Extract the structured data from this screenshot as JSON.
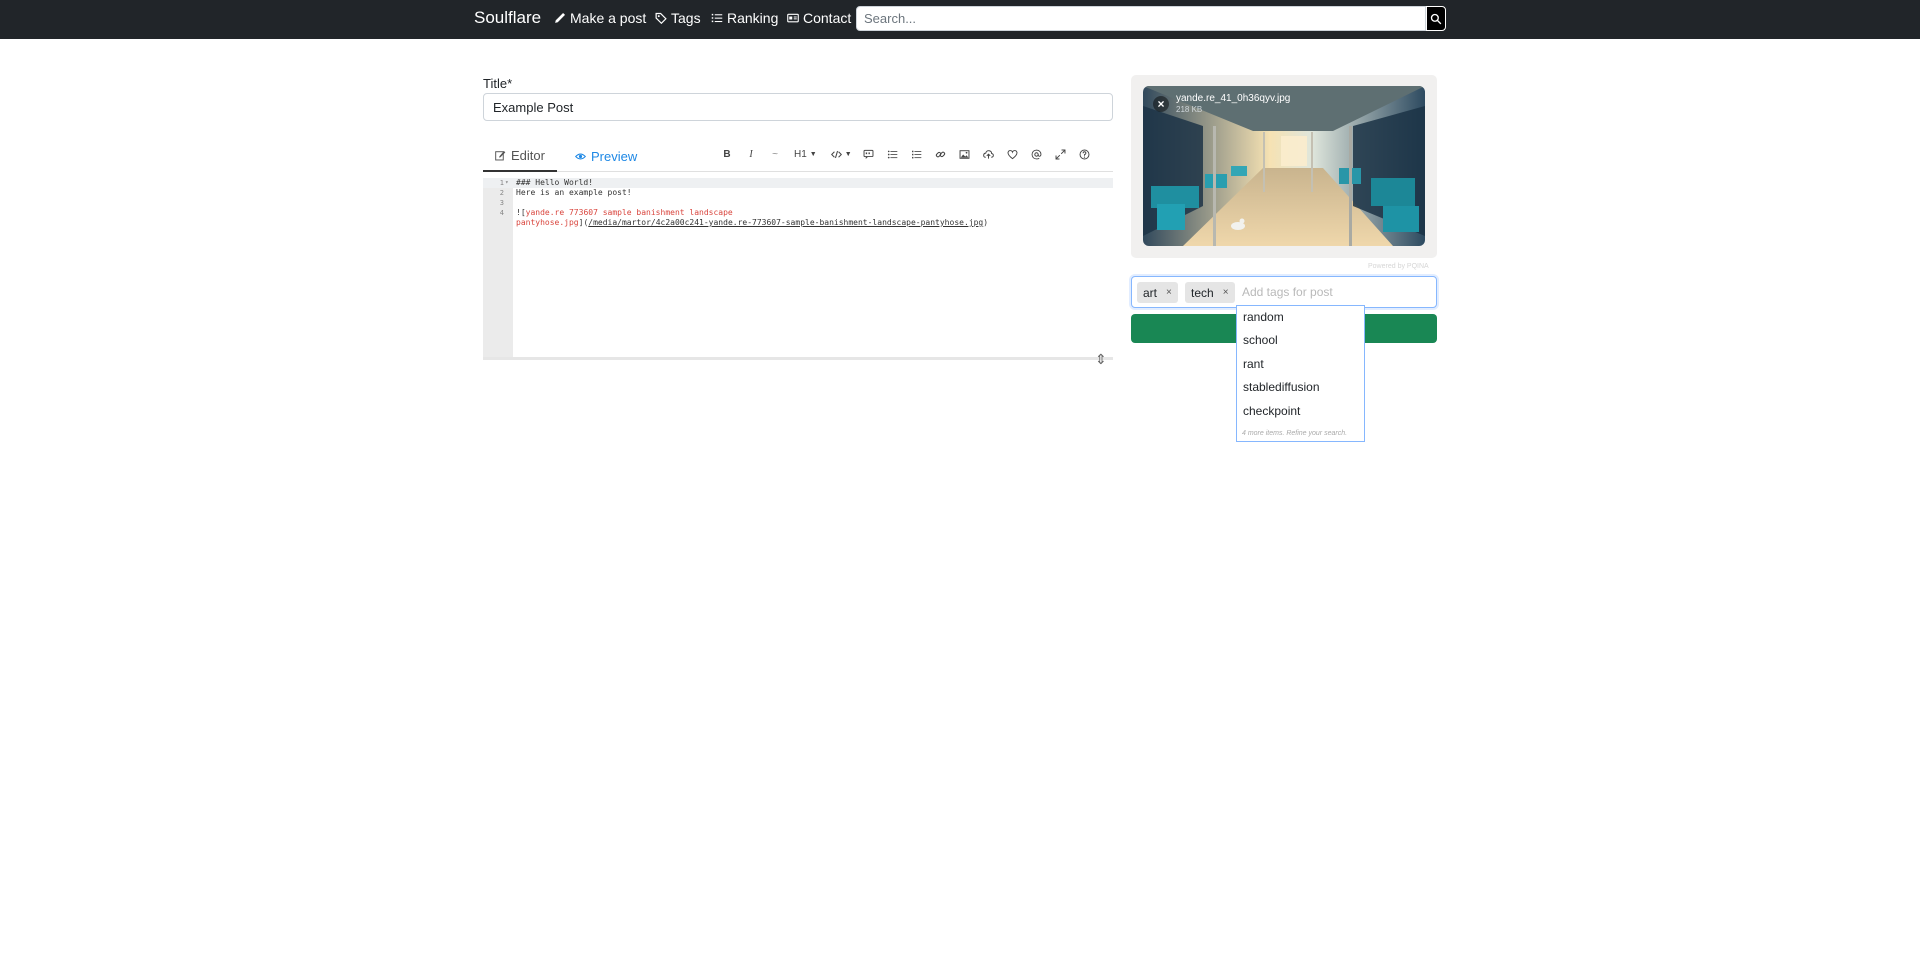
{
  "navbar": {
    "brand": "Soulflare",
    "items": [
      {
        "label": "Make a post",
        "icon": "pencil-icon"
      },
      {
        "label": "Tags",
        "icon": "tag-icon"
      },
      {
        "label": "Ranking",
        "icon": "list-icon"
      },
      {
        "label": "Contact",
        "icon": "contact-card-icon"
      }
    ],
    "search_placeholder": "Search...",
    "search_icon": "search-icon"
  },
  "form": {
    "title_label": "Title*",
    "title_value": "Example Post"
  },
  "editor": {
    "tabs": [
      {
        "label": "Editor",
        "icon": "edit-icon",
        "active": true
      },
      {
        "label": "Preview",
        "icon": "eye-icon",
        "active": false
      }
    ],
    "toolbar": {
      "bold": "B",
      "italic": "I",
      "strikethrough": "~",
      "heading": "H1",
      "code_icon": "code-icon",
      "tools": [
        "quote-icon",
        "bullet-list-icon",
        "numbered-list-icon",
        "link-icon",
        "image-icon",
        "upload-icon",
        "heart-icon",
        "mention-icon",
        "fullscreen-icon",
        "help-icon"
      ]
    },
    "lines": [
      {
        "num": "1",
        "text": "### Hello World!"
      },
      {
        "num": "2",
        "text": "Here is an example post!"
      },
      {
        "num": "3",
        "text": ""
      },
      {
        "num": "4",
        "prefix": "![",
        "alt": "yande.re 773607 sample banishment landscape",
        "alt_cont": "pantyhose.jpg",
        "mid": "](",
        "url": "/media/martor/4c2a00c241-yande.re-773607-sample-banishment-landscape-pantyhose.jpg",
        "suffix": ")"
      }
    ]
  },
  "upload": {
    "file_name": "yande.re_41_0h36qyv.jpg",
    "file_size": "218 KB",
    "powered_by": "Powered by PQINA"
  },
  "tags": {
    "selected": [
      "art",
      "tech"
    ],
    "remove_glyph": "×",
    "placeholder": "Add tags for post",
    "suggestions": [
      "random",
      "school",
      "rant",
      "stablediffusion",
      "checkpoint"
    ],
    "more_text": "4 more items. Refine your search."
  },
  "colors": {
    "navbar": "#212529",
    "accent_blue": "#1e88e5",
    "submit_green": "#198754"
  }
}
